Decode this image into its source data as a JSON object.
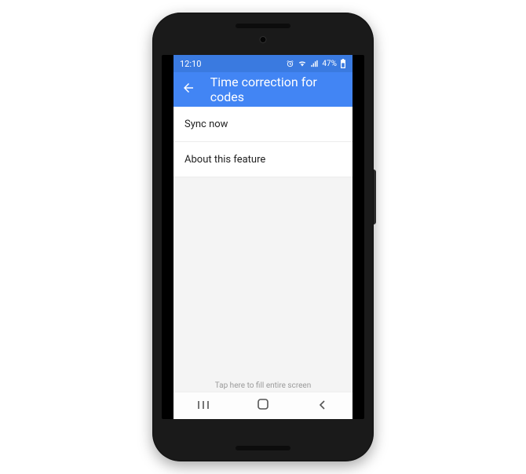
{
  "status": {
    "time": "12:10",
    "battery_pct": "47%"
  },
  "appbar": {
    "title": "Time correction for codes"
  },
  "list": {
    "items": [
      {
        "label": "Sync now"
      },
      {
        "label": "About this feature"
      }
    ]
  },
  "footer": {
    "hint": "Tap here to fill entire screen"
  }
}
